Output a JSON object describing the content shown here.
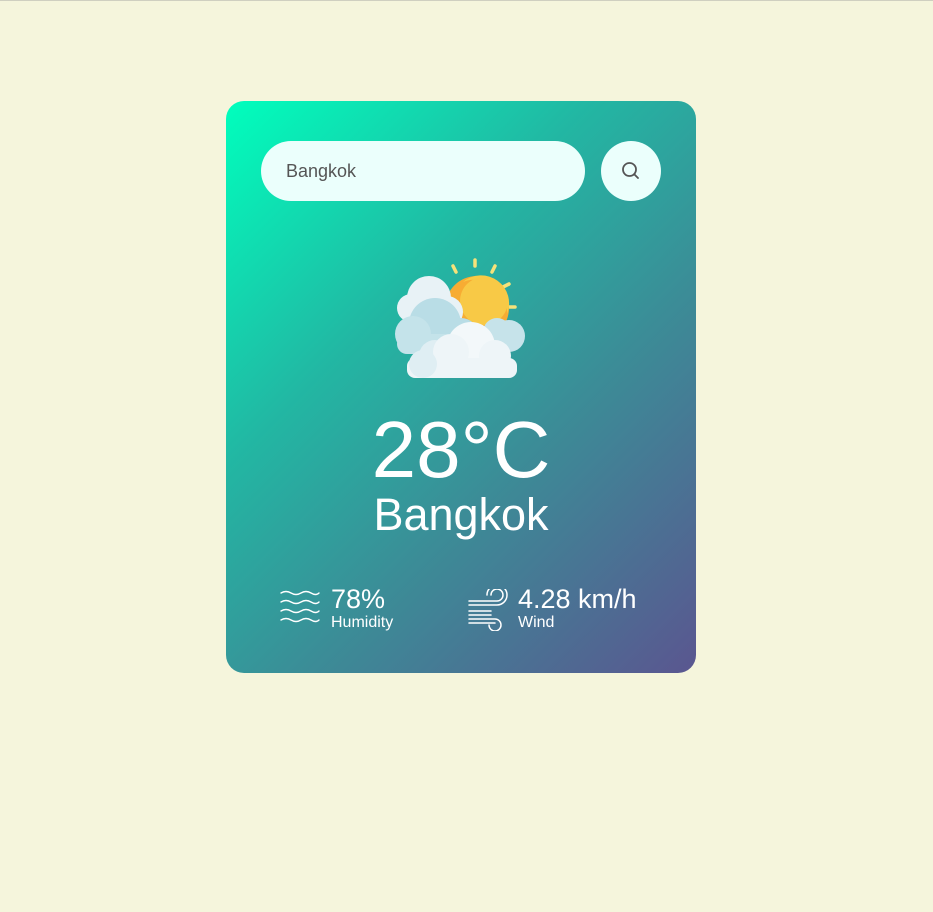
{
  "search": {
    "value": "Bangkok"
  },
  "weather": {
    "icon": "partly-cloudy-icon",
    "temperature": "28°C",
    "city": "Bangkok"
  },
  "details": {
    "humidity": {
      "value": "78%",
      "label": "Humidity",
      "icon": "humidity-waves-icon"
    },
    "wind": {
      "value": "4.28 km/h",
      "label": "Wind",
      "icon": "wind-icon"
    }
  },
  "colors": {
    "page_background": "#f5f5dc",
    "gradient_start": "#00ffbd",
    "gradient_end": "#5a5690",
    "input_background": "#ebfffc",
    "text": "#ffffff"
  }
}
